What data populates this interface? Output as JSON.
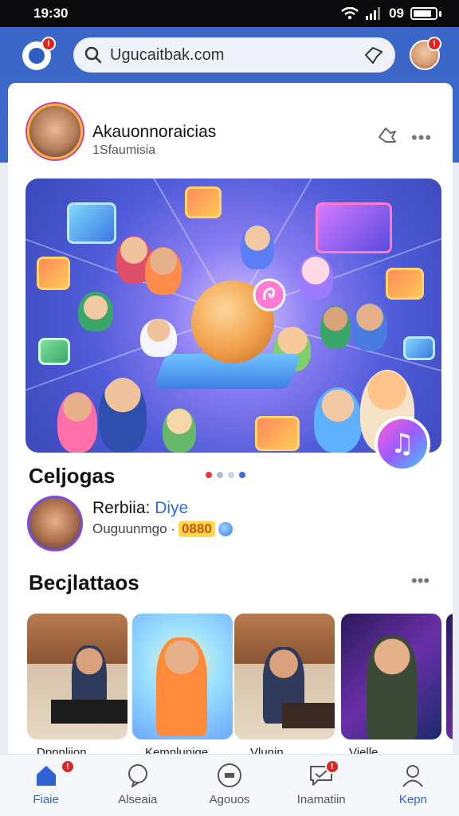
{
  "status_bar": {
    "time": "19:30",
    "net_label": "09"
  },
  "header": {
    "notification_count": "!",
    "search": {
      "value": "Ugucaitbak.com",
      "placeholder": "Ugucaitbak.com"
    },
    "avatar_badge": "!"
  },
  "profile": {
    "name": "Akauonnoraicias",
    "subtitle": "1Sfaumisia"
  },
  "carousel": {
    "title": "Celjogas",
    "dots": 4,
    "active_dot": 0
  },
  "featured_item": {
    "title_main": "Rerbiia: ",
    "title_accent": "Diye",
    "subtitle": "Ouguunmgo ·",
    "coins": "0880"
  },
  "section2": {
    "title": "Becjlattaos",
    "thumbnails": [
      {
        "label": "Dppnliion"
      },
      {
        "label": "Kemnlunige"
      },
      {
        "label": "Vlunin"
      },
      {
        "label": "Vielle"
      }
    ]
  },
  "bottom_nav": [
    {
      "label": "Fiaie",
      "badge": "!"
    },
    {
      "label": "Alseaia"
    },
    {
      "label": "Agouos"
    },
    {
      "label": "Inamatiin",
      "badge": "!"
    },
    {
      "label": "Kepn"
    }
  ],
  "colors": {
    "brand_blue": "#3a66c7",
    "accent_blue": "#2f6de0",
    "badge_red": "#e02424"
  }
}
